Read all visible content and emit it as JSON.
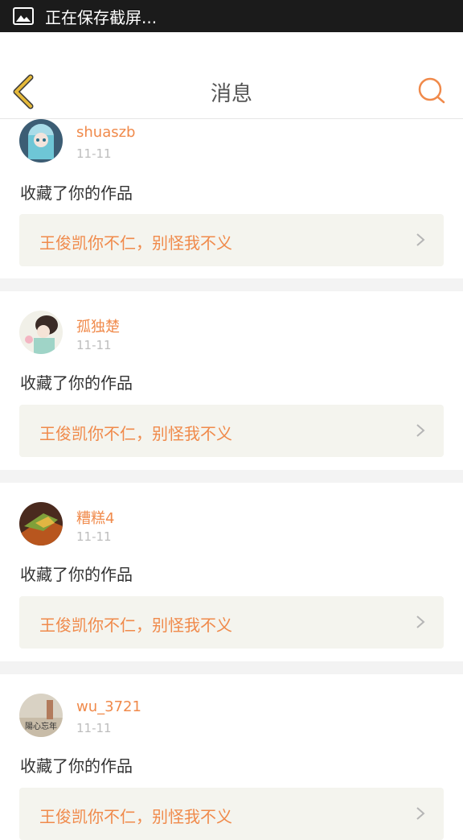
{
  "status_bar": {
    "notification_text": "正在保存截屏..."
  },
  "header": {
    "title": "消息"
  },
  "messages": [
    {
      "username": "shuaszb",
      "time": "11-11",
      "action": "收藏了你的作品",
      "work_title": "王俊凯你不仁，别怪我不义"
    },
    {
      "username": "孤独楚",
      "time": "11-11",
      "action": "收藏了你的作品",
      "work_title": "王俊凯你不仁，别怪我不义"
    },
    {
      "username": "糟糕4",
      "time": "11-11",
      "action": "收藏了你的作品",
      "work_title": "王俊凯你不仁，别怪我不义"
    },
    {
      "username": "wu_3721",
      "time": "11-11",
      "action": "收藏了你的作品",
      "work_title": "王俊凯你不仁，别怪我不义",
      "avatar_text": "陽心忘年"
    }
  ],
  "colors": {
    "accent": "#f08a4b",
    "back_arrow": "#e5b93a",
    "card_bg": "#f4f4ee",
    "separator": "#f3f3f3"
  }
}
